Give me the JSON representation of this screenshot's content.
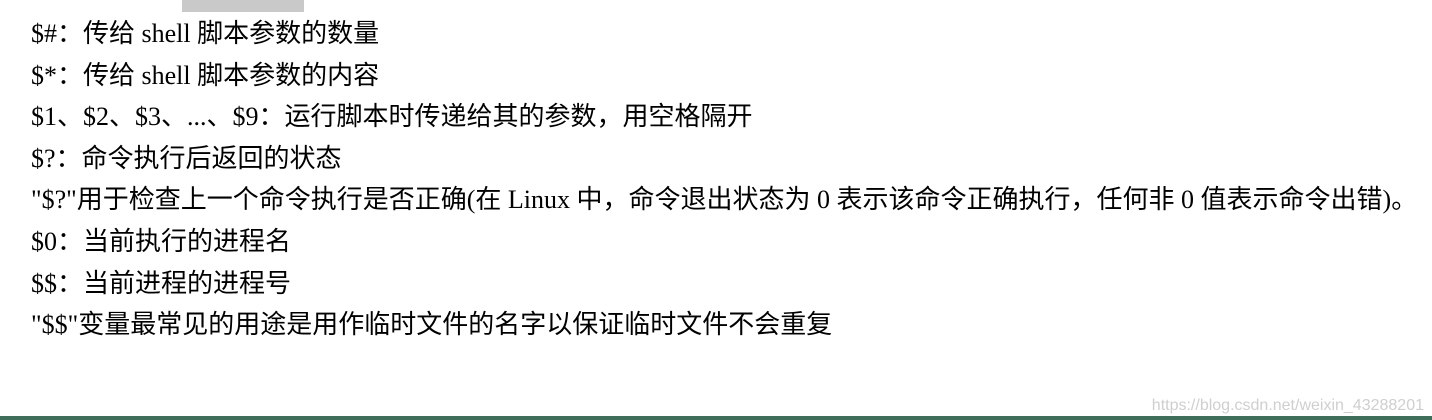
{
  "document": {
    "lines": [
      "$#：传给 shell 脚本参数的数量",
      "$*：传给 shell 脚本参数的内容",
      "$1、$2、$3、...、$9：运行脚本时传递给其的参数，用空格隔开",
      "$?：命令执行后返回的状态",
      "\"$?\"用于检查上一个命令执行是否正确(在 Linux 中，命令退出状态为 0 表示该命令正确执行，任何非 0 值表示命令出错)。",
      "$0：当前执行的进程名",
      "$$：当前进程的进程号",
      "\"$$\"变量最常见的用途是用作临时文件的名字以保证临时文件不会重复"
    ]
  },
  "watermark": "https://blog.csdn.net/weixin_43288201",
  "colors": {
    "text": "#000000",
    "watermark": "#cfcfcf",
    "bottom_rule": "#3f6f5a"
  }
}
